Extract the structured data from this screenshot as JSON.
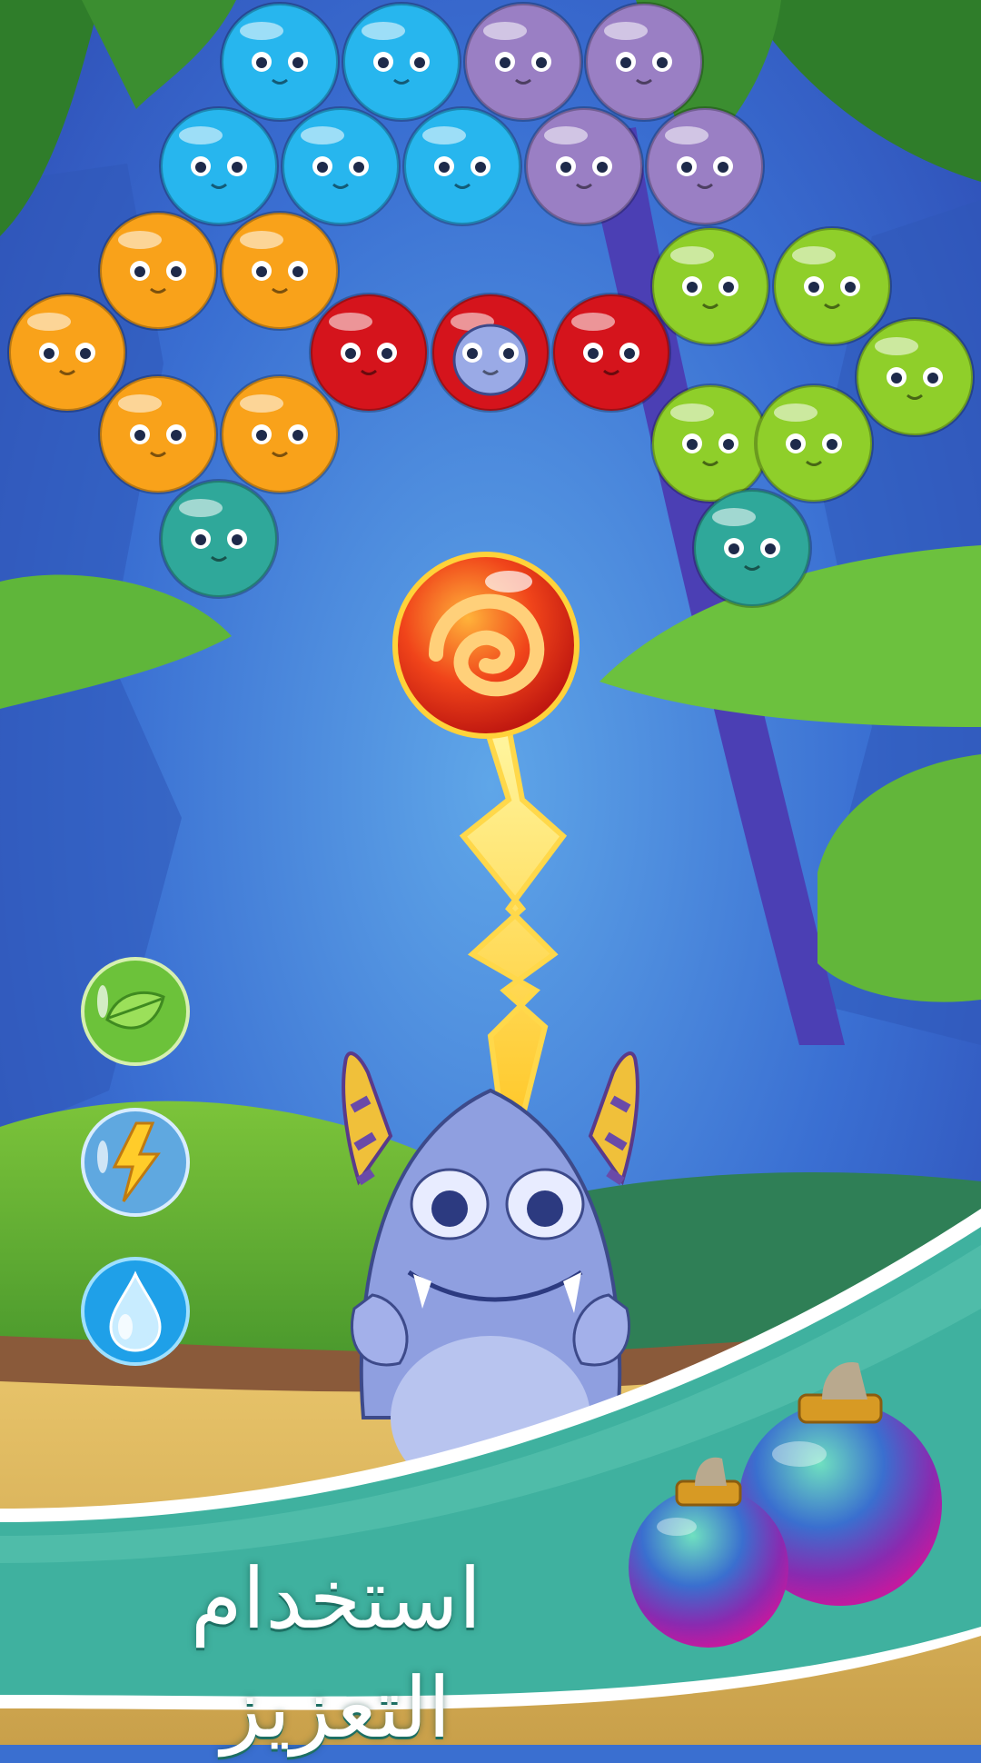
{
  "caption": "استخدام التعزيز",
  "bubble_grid": [
    {
      "color": "blue"
    },
    {
      "color": "blue"
    },
    {
      "color": "purple"
    },
    {
      "color": "purple"
    },
    {
      "color": "blue"
    },
    {
      "color": "blue"
    },
    {
      "color": "blue"
    },
    {
      "color": "purple"
    },
    {
      "color": "purple"
    },
    {
      "color": "orange"
    },
    {
      "color": "orange"
    },
    {
      "color": "orange"
    },
    {
      "color": "red"
    },
    {
      "color": "red",
      "special": "monster-inside"
    },
    {
      "color": "red"
    },
    {
      "color": "green"
    },
    {
      "color": "green"
    },
    {
      "color": "green"
    },
    {
      "color": "orange"
    },
    {
      "color": "orange"
    },
    {
      "color": "green"
    },
    {
      "color": "green"
    },
    {
      "color": "teal"
    },
    {
      "color": "teal"
    }
  ],
  "shooter": {
    "bubble": "fire-bubble",
    "effect": "lightning"
  },
  "boosters": [
    {
      "name": "leaf-booster",
      "icon": "leaf-icon"
    },
    {
      "name": "lightning-booster",
      "icon": "lightning-icon"
    },
    {
      "name": "water-booster",
      "icon": "water-drop-icon"
    }
  ],
  "colors": {
    "blue": "#27b6ee",
    "purple": "#9a7fc4",
    "orange": "#f9a21a",
    "red": "#d5141c",
    "green": "#8fcf2a",
    "teal": "#2fa89a",
    "banner": "#3fb19f"
  }
}
